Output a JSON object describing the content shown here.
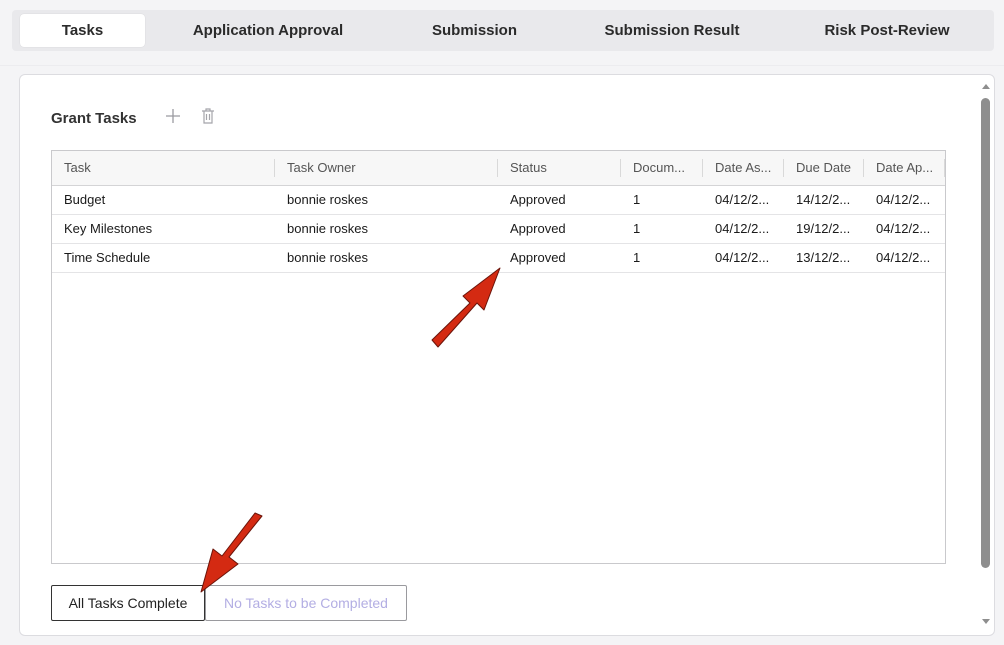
{
  "tabs": [
    {
      "label": "Tasks",
      "active": true
    },
    {
      "label": "Application Approval",
      "active": false
    },
    {
      "label": "Submission",
      "active": false
    },
    {
      "label": "Submission Result",
      "active": false
    },
    {
      "label": "Risk Post-Review",
      "active": false
    }
  ],
  "panel": {
    "title": "Grant Tasks",
    "add_icon": "plus-icon",
    "delete_icon": "trash-icon"
  },
  "table": {
    "columns": [
      "Task",
      "Task Owner",
      "Status",
      "Docum...",
      "Date As...",
      "Due Date",
      "Date Ap..."
    ],
    "rows": [
      [
        "Budget",
        "bonnie roskes",
        "Approved",
        "1",
        "04/12/2...",
        "14/12/2...",
        "04/12/2..."
      ],
      [
        "Key Milestones",
        "bonnie roskes",
        "Approved",
        "1",
        "04/12/2...",
        "19/12/2...",
        "04/12/2..."
      ],
      [
        "Time Schedule",
        "bonnie roskes",
        "Approved",
        "1",
        "04/12/2...",
        "13/12/2...",
        "04/12/2..."
      ]
    ]
  },
  "buttons": {
    "all_complete": "All Tasks Complete",
    "none_complete": "No Tasks to be Completed"
  },
  "colors": {
    "annotation_arrow": "#d42a12",
    "disabled_text": "#b3aee3"
  }
}
